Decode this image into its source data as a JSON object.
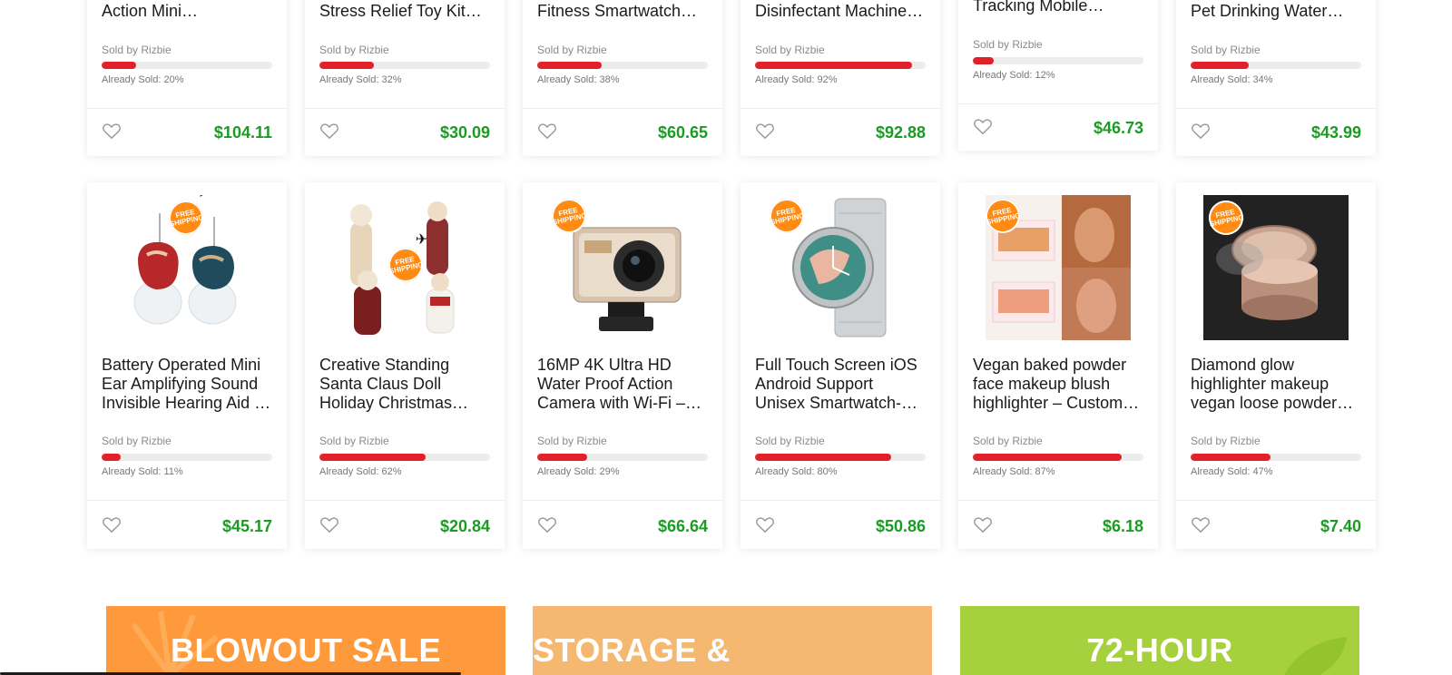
{
  "row1": [
    {
      "title": "Action Mini Cameras-…",
      "seller": "Sold by Rizbie",
      "sold_text": "Already Sold: 20%",
      "sold_pct": 20,
      "price": "$104.11"
    },
    {
      "title": "Stress Relief Toy Kit –…",
      "seller": "Sold by Rizbie",
      "sold_text": "Already Sold: 32%",
      "sold_pct": 32,
      "price": "$30.09"
    },
    {
      "title": "Fitness Smartwatch –…",
      "seller": "Sold by Rizbie",
      "sold_text": "Already Sold: 38%",
      "sold_pct": 38,
      "price": "$60.65"
    },
    {
      "title": "Disinfectant Machine …",
      "seller": "Sold by Rizbie",
      "sold_text": "Already Sold: 92%",
      "sold_pct": 92,
      "price": "$92.88"
    },
    {
      "title": "Tracking Mobile Phon…",
      "seller": "Sold by Rizbie",
      "sold_text": "Already Sold: 12%",
      "sold_pct": 12,
      "price": "$46.73"
    },
    {
      "title": "Pet Drinking Water…",
      "seller": "Sold by Rizbie",
      "sold_text": "Already Sold: 34%",
      "sold_pct": 34,
      "price": "$43.99"
    }
  ],
  "row2": [
    {
      "title": "Battery Operated Mini Ear Amplifying Sound Invisible Hearing Aid …",
      "seller": "Sold by Rizbie",
      "sold_text": "Already Sold: 11%",
      "sold_pct": 11,
      "price": "$45.17",
      "image": "hearing-aid"
    },
    {
      "title": "Creative Standing Santa Claus Doll Holiday Christmas…",
      "seller": "Sold by Rizbie",
      "sold_text": "Already Sold: 62%",
      "sold_pct": 62,
      "price": "$20.84",
      "image": "santa-dolls"
    },
    {
      "title": "16MP 4K Ultra HD Water Proof Action Camera with Wi-Fi –…",
      "seller": "Sold by Rizbie",
      "sold_text": "Already Sold: 29%",
      "sold_pct": 29,
      "price": "$66.64",
      "image": "action-camera"
    },
    {
      "title": "Full Touch Screen iOS Android Support Unisex Smartwatch- USB…",
      "seller": "Sold by Rizbie",
      "sold_text": "Already Sold: 80%",
      "sold_pct": 80,
      "price": "$50.86",
      "image": "smartwatch"
    },
    {
      "title": "Vegan baked powder face makeup blush highlighter – Custom…",
      "seller": "Sold by Rizbie",
      "sold_text": "Already Sold: 87%",
      "sold_pct": 87,
      "price": "$6.18",
      "image": "blush-palette"
    },
    {
      "title": "Diamond glow highlighter makeup vegan loose powder –…",
      "seller": "Sold by Rizbie",
      "sold_text": "Already Sold: 47%",
      "sold_pct": 47,
      "price": "$7.40",
      "image": "loose-powder"
    }
  ],
  "badge_text": "FREE SHIPPING",
  "banners": [
    {
      "label": "BLOWOUT SALE",
      "color": "#ff9a3c"
    },
    {
      "label": "STORAGE & ORGANIZATION",
      "color": "#f5b870"
    },
    {
      "label": "72-HOUR",
      "color": "#a6d03e"
    }
  ],
  "colors": {
    "price": "#1c9b24",
    "progress": "#e2202a",
    "badge": "#ff8a14"
  }
}
